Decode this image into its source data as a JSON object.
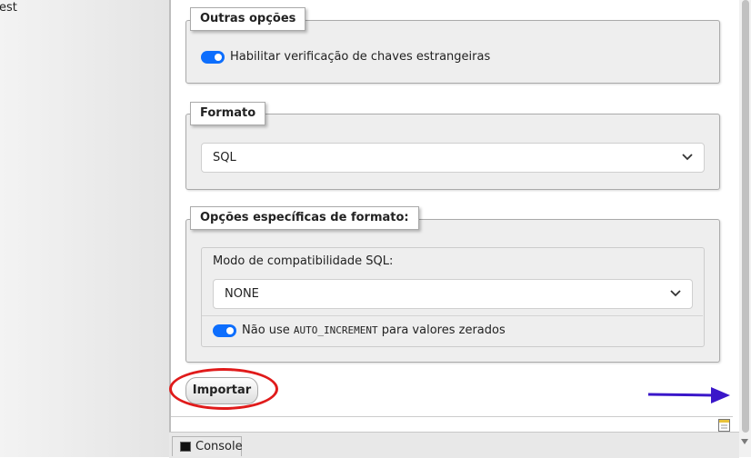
{
  "sidebar": {
    "partial_text": "est"
  },
  "outras_opcoes": {
    "legend": "Outras opções",
    "toggle_label": "Habilitar verificação de chaves estrangeiras",
    "toggle_on": true
  },
  "formato": {
    "legend": "Formato",
    "selected": "SQL"
  },
  "opcoes_especificas": {
    "legend": "Opções específicas de formato:",
    "compat_label": "Modo de compatibilidade SQL:",
    "compat_selected": "NONE",
    "auto_inc_prefix": "Não use ",
    "auto_inc_code": "AUTO_INCREMENT",
    "auto_inc_suffix": " para valores zerados",
    "auto_inc_on": true
  },
  "actions": {
    "import_label": "Importar"
  },
  "console": {
    "label": "Console"
  },
  "colors": {
    "toggle_accent": "#0d6efd",
    "annotation_circle": "#e01b1b",
    "annotation_arrow": "#3a17c9"
  }
}
